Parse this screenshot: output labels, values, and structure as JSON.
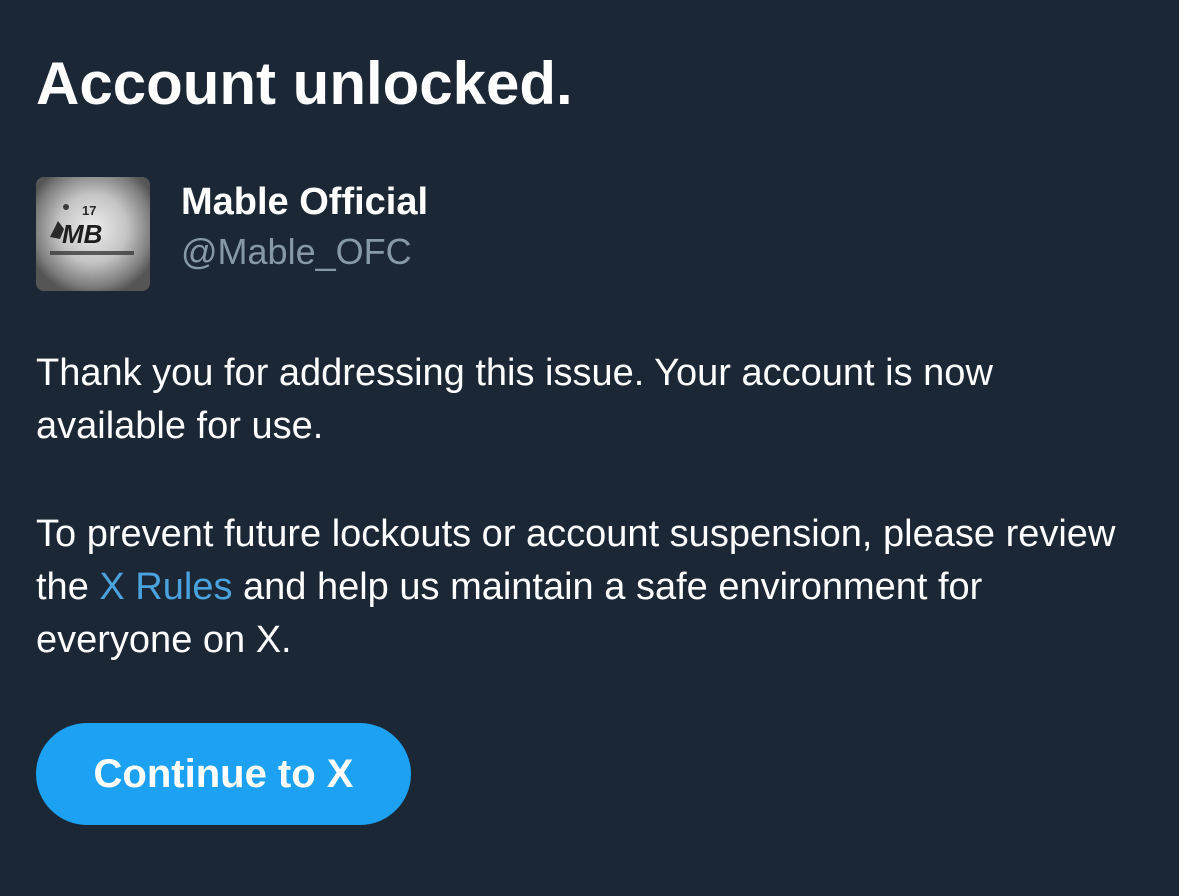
{
  "colors": {
    "background": "#1b2735",
    "text_primary": "#ffffff",
    "text_secondary": "#8899a6",
    "link": "#4aa3df",
    "button": "#1da1f2"
  },
  "header": {
    "title": "Account unlocked."
  },
  "account": {
    "display_name": "Mable Official",
    "handle": "@Mable_OFC",
    "avatar_icon": "mb-logo-avatar",
    "avatar_text": "MB"
  },
  "message": {
    "paragraph1": "Thank you for addressing this issue. Your account is now available for use.",
    "paragraph2_before": "To prevent future lockouts or account suspension, please review the ",
    "paragraph2_link": "X Rules",
    "paragraph2_after": " and help us maintain a safe environment for everyone on X."
  },
  "actions": {
    "continue_label": "Continue to X"
  }
}
